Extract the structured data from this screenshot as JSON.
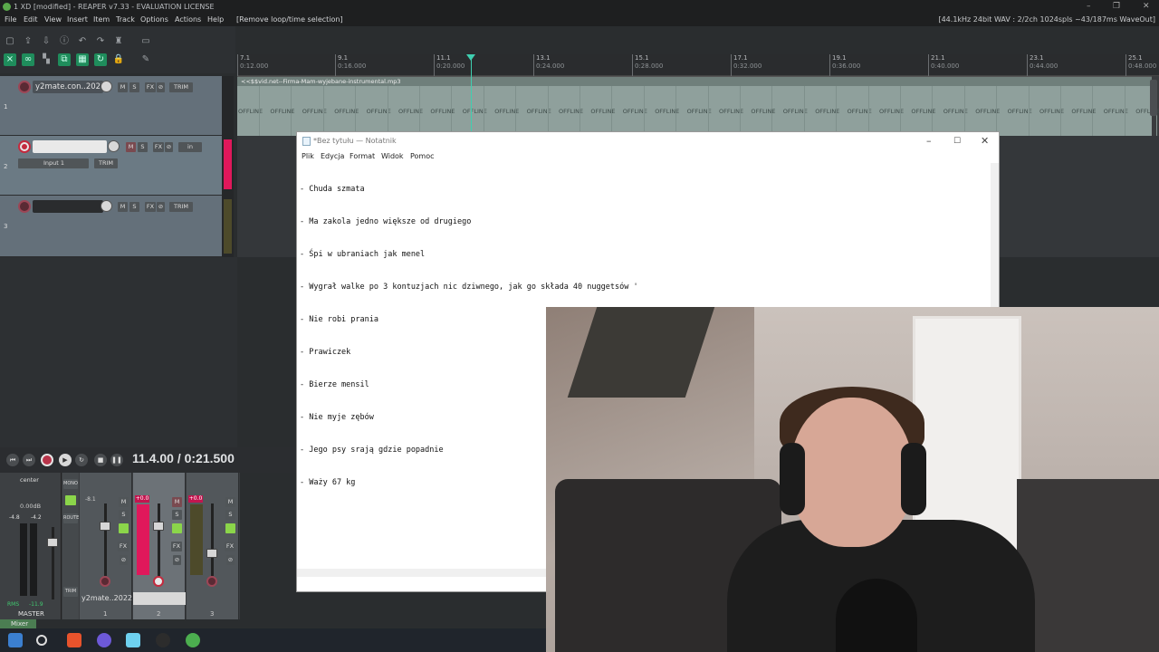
{
  "window": {
    "title": "1 XD [modified] - REAPER v7.33 - EVALUATION LICENSE",
    "min": "–",
    "max": "❐",
    "close": "✕"
  },
  "menu": {
    "items": [
      "File",
      "Edit",
      "View",
      "Insert",
      "Item",
      "Track",
      "Options",
      "Actions",
      "Help",
      "[Remove loop/time selection]"
    ],
    "status": "[44.1kHz 24bit WAV : 2/2ch 1024spls ~43/187ms WaveOut]"
  },
  "ruler": {
    "ticks": [
      {
        "bar": "7.1",
        "time": "0:12.000"
      },
      {
        "bar": "9.1",
        "time": "0:16.000"
      },
      {
        "bar": "11.1",
        "time": "0:20.000"
      },
      {
        "bar": "13.1",
        "time": "0:24.000"
      },
      {
        "bar": "15.1",
        "time": "0:28.000"
      },
      {
        "bar": "17.1",
        "time": "0:32.000"
      },
      {
        "bar": "19.1",
        "time": "0:36.000"
      },
      {
        "bar": "21.1",
        "time": "0:40.000"
      },
      {
        "bar": "23.1",
        "time": "0:44.000"
      },
      {
        "bar": "25.1",
        "time": "0:48.000"
      }
    ]
  },
  "tracks": [
    {
      "num": "1",
      "name": "y2mate.con..2022"
    },
    {
      "num": "2",
      "name": "",
      "input": "Input 1",
      "inmon": "in"
    },
    {
      "num": "3",
      "name": ""
    }
  ],
  "track_buttons": {
    "m": "M",
    "s": "S",
    "fx": "FX",
    "io": "⊘",
    "trim": "TRIM"
  },
  "item": {
    "header": "<<$$vid.net--Firma-Mam-wyjebane-instrumental.mp3",
    "offline_label": "OFFLINE"
  },
  "transport": {
    "timecode": "11.4.00 / 0:21.500"
  },
  "mixer": {
    "master_label": "MASTER",
    "center": "center",
    "db": "0.00dB",
    "left_level": "-4.8",
    "right_level": "-4.2",
    "rms": "RMS",
    "rms_value": "-11.9",
    "mono": "MONO",
    "route": "ROUTE",
    "trim": "TRIM",
    "strip1_peak": "-8.1",
    "strip2_peak": "+0.0",
    "strip3_peak": "+0.0",
    "strip_name": "y2mate..2022",
    "strip_nums": [
      "1",
      "2",
      "3"
    ],
    "tab": "Mixer"
  },
  "notepad": {
    "title": "*Bez tytułu — Notatnik",
    "menu": [
      "Plik",
      "Edycja",
      "Format",
      "Widok",
      "Pomoc"
    ],
    "lines": [
      "- Chuda szmata",
      "- Ma zakola jedno większe od drugiego",
      "- Śpi w ubraniach jak menel",
      "- Wygrał walke po 3 kontuzjach nic dziwnego, jak go składa 40 nuggetsów '",
      "- Nie robi prania",
      "- Prawiczek",
      "- Bierze mensil",
      "- Nie myje zębów",
      "- Jego psy srają gdzie popadnie",
      "- Waży 67 kg"
    ]
  },
  "colors": {
    "accent": "#1f8d5c",
    "record": "#c42a3e",
    "meter_hot": "#e0185b",
    "playhead": "#3fcfb0"
  }
}
